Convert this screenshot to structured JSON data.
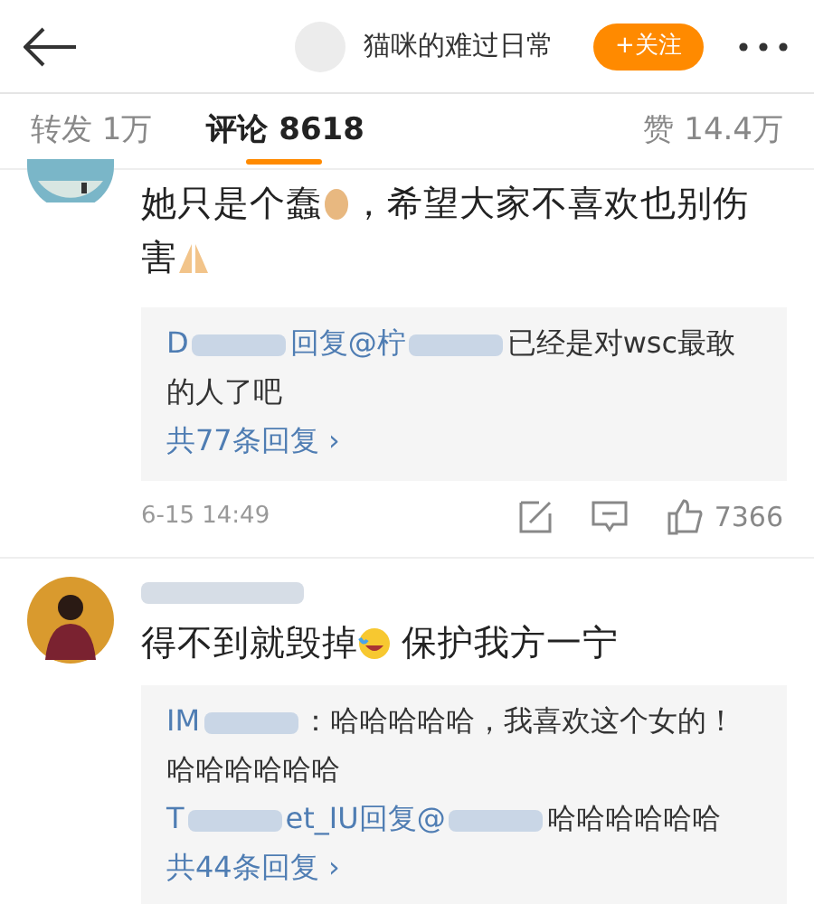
{
  "header": {
    "title": "猫咪的难过日常",
    "follow_button": "+关注"
  },
  "tabs": [
    {
      "label": "转发 1万",
      "selected": false
    },
    {
      "label": "评论 8618",
      "selected": true
    }
  ],
  "likes_total": "赞 14.4万",
  "comments": [
    {
      "body": [
        {
          "kind": "text",
          "text": "她只是个蠢"
        },
        {
          "kind": "egg"
        },
        {
          "kind": "text",
          "text": "，希望大家不喜欢也别伤害"
        },
        {
          "kind": "pray"
        }
      ],
      "replies": [
        [
          {
            "kind": "text",
            "text": "D"
          },
          {
            "kind": "blur"
          },
          {
            "kind": "text",
            "text": "回复@柠"
          },
          {
            "kind": "blur"
          },
          {
            "kind": "text",
            "text": "已经是对wsc最敢的人了吧"
          }
        ]
      ],
      "more": "共77条回复 ›",
      "time": "6-15 14:49",
      "likes": "7366"
    },
    {
      "username": [
        {
          "kind": "blur"
        }
      ],
      "body": [
        {
          "kind": "text",
          "text": "得不到就毁掉"
        },
        {
          "kind": "laugh"
        },
        {
          "kind": "text",
          "text": " 保护我方一宁"
        }
      ],
      "replies": [
        [
          {
            "kind": "text",
            "text": "IM"
          },
          {
            "kind": "blur"
          },
          {
            "kind": "text",
            "text": "：哈哈哈哈哈，我喜欢这个女的！哈哈哈哈哈哈"
          }
        ],
        [
          {
            "kind": "text",
            "text": "T"
          },
          {
            "kind": "blur"
          },
          {
            "kind": "text",
            "text": "et_IU回复@"
          },
          {
            "kind": "blur"
          },
          {
            "kind": "text",
            "text": "哈哈哈哈哈哈"
          }
        ]
      ],
      "more": "共44条回复 ›"
    }
  ]
}
